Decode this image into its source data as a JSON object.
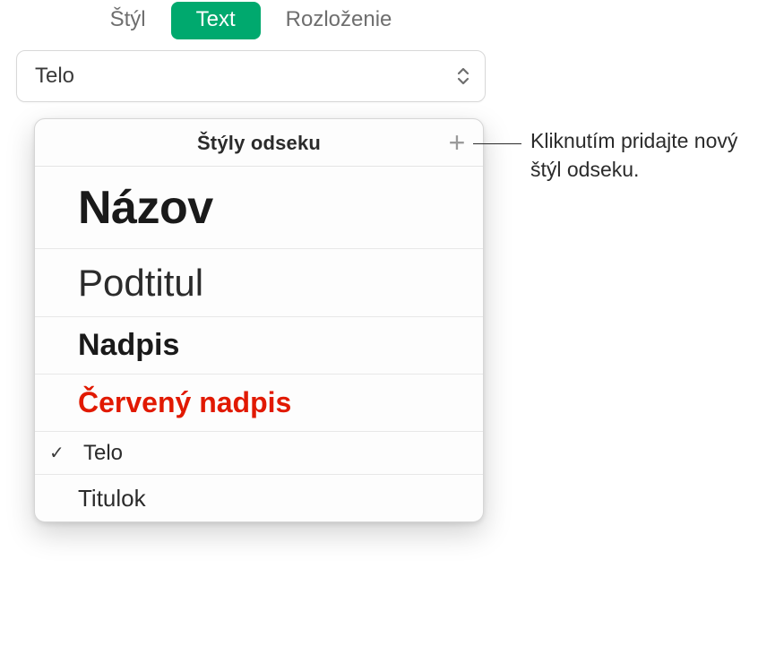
{
  "tabs": {
    "style": "Štýl",
    "text": "Text",
    "layout": "Rozloženie"
  },
  "dropdown": {
    "value": "Telo"
  },
  "popover": {
    "title": "Štýly odseku",
    "add_icon": "+",
    "items": [
      {
        "label": "Názov",
        "selected": false
      },
      {
        "label": "Podtitul",
        "selected": false
      },
      {
        "label": "Nadpis",
        "selected": false
      },
      {
        "label": "Červený nadpis",
        "selected": false
      },
      {
        "label": "Telo",
        "selected": true
      },
      {
        "label": "Titulok",
        "selected": false
      }
    ],
    "checkmark": "✓"
  },
  "callout": {
    "text": "Kliknutím pridajte nový štýl odseku."
  }
}
